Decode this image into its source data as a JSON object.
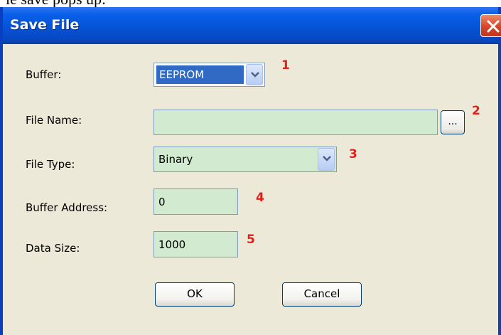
{
  "caption": "le save pops up:",
  "window": {
    "title": "Save File"
  },
  "form": {
    "buffer": {
      "label": "Buffer:",
      "value": "EEPROM",
      "marker": "1"
    },
    "file_name": {
      "label": "File Name:",
      "value": "",
      "browse_label": "...",
      "marker": "2"
    },
    "file_type": {
      "label": "File Type:",
      "value": "Binary",
      "marker": "3"
    },
    "buffer_address": {
      "label": "Buffer Address:",
      "value": "0",
      "marker": "4"
    },
    "data_size": {
      "label": "Data Size:",
      "value": "1000",
      "marker": "5"
    }
  },
  "buttons": {
    "ok": "OK",
    "cancel": "Cancel"
  },
  "colors": {
    "field_bg": "#d2ead0",
    "marker": "#e0201a",
    "titlebar": "#0553d6",
    "dialog_bg": "#ece9d8"
  },
  "icons": {
    "close": "close-icon",
    "combo": "chevron-down-icon"
  }
}
